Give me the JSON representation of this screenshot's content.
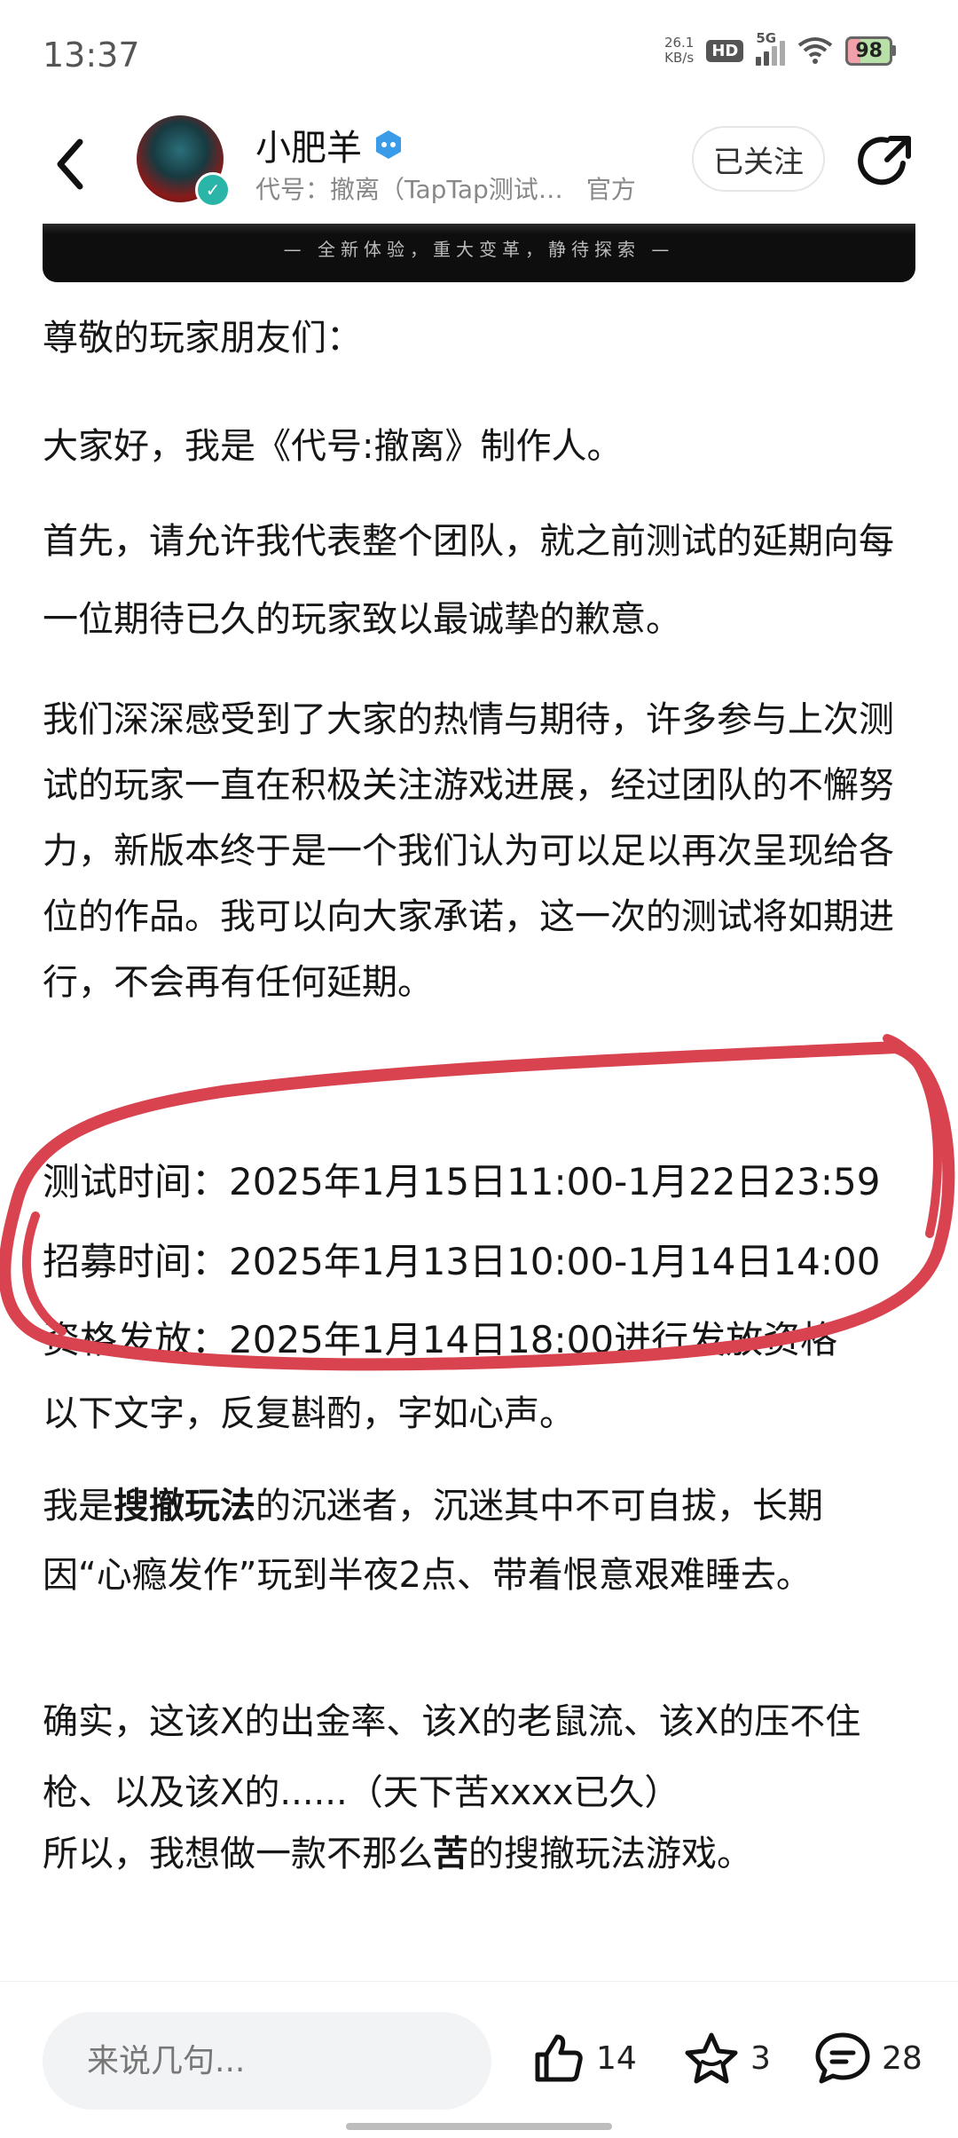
{
  "status_bar": {
    "time": "13:37",
    "net_speed_value": "26.1",
    "net_speed_unit": "KB/s",
    "hd": "HD",
    "network": "5G",
    "battery": "98"
  },
  "header": {
    "author_name": "小肥羊",
    "author_sub": "代号：撤离（TapTap测试…",
    "official": "官方",
    "follow_label": "已关注"
  },
  "banner": {
    "text": "— 全新体验，重大变革，静待探索 —"
  },
  "article": {
    "greeting": "尊敬的玩家朋友们：",
    "intro": "大家好，我是《代号:撤离》制作人。",
    "apology": "首先，请允许我代表整个团队，就之前测试的延期向每一位期待已久的玩家致以最诚挚的歉意。",
    "thanks": "我们深深感受到了大家的热情与期待，许多参与上次测试的玩家一直在积极关注游戏进展，经过团队的不懈努力，新版本终于是一个我们认为可以足以再次呈现给各位的作品。我可以向大家承诺，这一次的测试将如期进行，不会再有任何延期。",
    "schedule": [
      {
        "label": "测试时间：",
        "value": "2025年1月15日11:00-1月22日23:59"
      },
      {
        "label": "招募时间：",
        "value": "2025年1月13日10:00-1月14日14:00"
      },
      {
        "label": "资格发放：",
        "value": "2025年1月14日18:00进行发放资格"
      }
    ],
    "words": "以下文字，反复斟酌，字如心声。",
    "me_prefix": "我是",
    "me_bold": "搜撤玩法",
    "me_suffix": "的沉迷者，沉迷其中不可自拔，长期因“心瘾发作”玩到半夜2点、带着恨意艰难睡去。",
    "indeed": "确实，这该X的出金率、该X的老鼠流、该X的压不住枪、以及该X的......（天下苦xxxx已久）",
    "so_prefix": "所以，我想做一款不那么",
    "so_bold": "苦",
    "so_suffix": "的搜撤玩法游戏。"
  },
  "bottom_bar": {
    "comment_placeholder": "来说几句...",
    "like_count": "14",
    "favorite_count": "3",
    "comment_count": "28"
  },
  "colors": {
    "annotation_red": "#d9434f",
    "verified_blue": "#3a9ce8",
    "badge_teal": "#2bb5a8"
  },
  "icons": [
    "back-arrow-icon",
    "verified-icon",
    "share-icon",
    "like-icon",
    "star-icon",
    "comment-icon"
  ]
}
